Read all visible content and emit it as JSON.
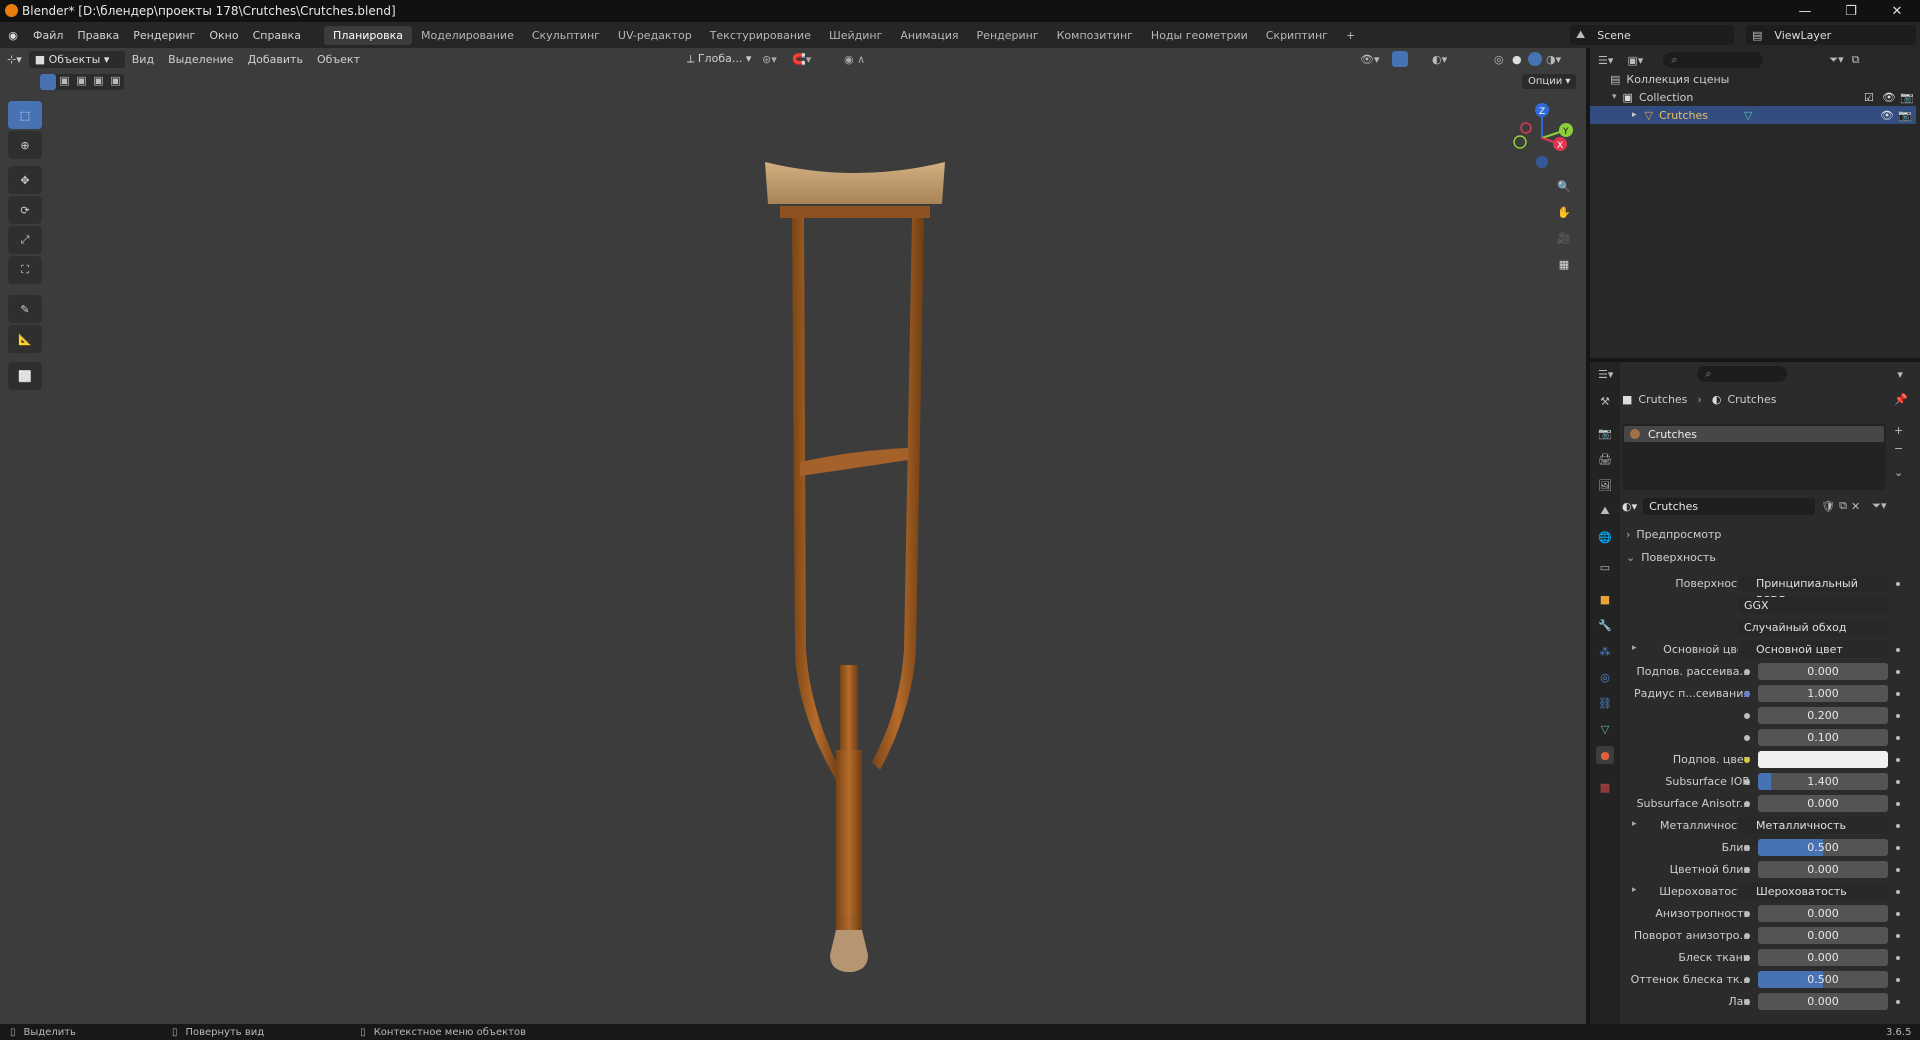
{
  "window": {
    "title": "Blender* [D:\\блендер\\проекты 178\\Crutches\\Crutches.blend]",
    "minimize": "—",
    "maximize": "❐",
    "close": "✕"
  },
  "menubar": {
    "menus": [
      "Файл",
      "Правка",
      "Рендеринг",
      "Окно",
      "Справка"
    ],
    "workspaces": [
      "Планировка",
      "Моделирование",
      "Скульптинг",
      "UV-редактор",
      "Текстурирование",
      "Шейдинг",
      "Анимация",
      "Рендеринг",
      "Композитинг",
      "Ноды геометрии",
      "Скриптинг"
    ],
    "active_workspace": "Планировка",
    "add_tab": "+",
    "scene": "Scene",
    "view_layer": "ViewLayer"
  },
  "viewport_header": {
    "mode": "Объекты",
    "menus": [
      "Вид",
      "Выделение",
      "Добавить",
      "Объект"
    ],
    "transform_orientation": "Глоба...",
    "options": "Опции"
  },
  "gizmo": {
    "x": "X",
    "y": "Y",
    "z": "Z"
  },
  "outliner": {
    "scene_collection": "Коллекция сцены",
    "collection": "Collection",
    "object": "Crutches"
  },
  "properties": {
    "breadcrumb": [
      "Crutches",
      "Crutches"
    ],
    "material_slot": "Crutches",
    "material_name": "Crutches",
    "preview_section": "Предпросмотр",
    "surface_section": "Поверхность",
    "rows": [
      {
        "label": "Поверхность",
        "kind": "link",
        "value": "Принципиальный BSDF",
        "dot": "green"
      },
      {
        "label": "",
        "kind": "dropdown",
        "value": "GGX"
      },
      {
        "label": "",
        "kind": "dropdown",
        "value": "Случайный обход"
      },
      {
        "label": "Основной цвет",
        "kind": "link",
        "value": "Основной цвет",
        "dot": "yellow",
        "expand": true
      },
      {
        "label": "Подпов. рассеива...",
        "kind": "number",
        "value": "0.000",
        "fill": 0
      },
      {
        "label": "Радиус п...сеивания",
        "kind": "number",
        "value": "1.000",
        "fill": 0,
        "dot": "blue"
      },
      {
        "label": "",
        "kind": "number",
        "value": "0.200",
        "fill": 0
      },
      {
        "label": "",
        "kind": "number",
        "value": "0.100",
        "fill": 0
      },
      {
        "label": "Подпов. цвет",
        "kind": "color",
        "value": "",
        "color": "#f0f0f0",
        "dot": "yellow"
      },
      {
        "label": "Subsurface IOR",
        "kind": "number",
        "value": "1.400",
        "fill": 10
      },
      {
        "label": "Subsurface Anisotr...",
        "kind": "number",
        "value": "0.000",
        "fill": 0
      },
      {
        "label": "Металличность",
        "kind": "link",
        "value": "Металличность",
        "dot": "gray",
        "expand": true
      },
      {
        "label": "Блик",
        "kind": "number",
        "value": "0.500",
        "fill": 50
      },
      {
        "label": "Цветной блик",
        "kind": "number",
        "value": "0.000",
        "fill": 0
      },
      {
        "label": "Шероховатость",
        "kind": "link",
        "value": "Шероховатость",
        "dot": "gray",
        "expand": true
      },
      {
        "label": "Анизотропность",
        "kind": "number",
        "value": "0.000",
        "fill": 0
      },
      {
        "label": "Поворот анизотро...",
        "kind": "number",
        "value": "0.000",
        "fill": 0
      },
      {
        "label": "Блеск ткани",
        "kind": "number",
        "value": "0.000",
        "fill": 0
      },
      {
        "label": "Оттенок блеска тк...",
        "kind": "number",
        "value": "0.500",
        "fill": 50
      },
      {
        "label": "Лак",
        "kind": "number",
        "value": "0.000",
        "fill": 0
      }
    ]
  },
  "statusbar": {
    "select": "Выделить",
    "rotate": "Повернуть вид",
    "context": "Контекстное меню объектов",
    "version": "3.6.5"
  }
}
